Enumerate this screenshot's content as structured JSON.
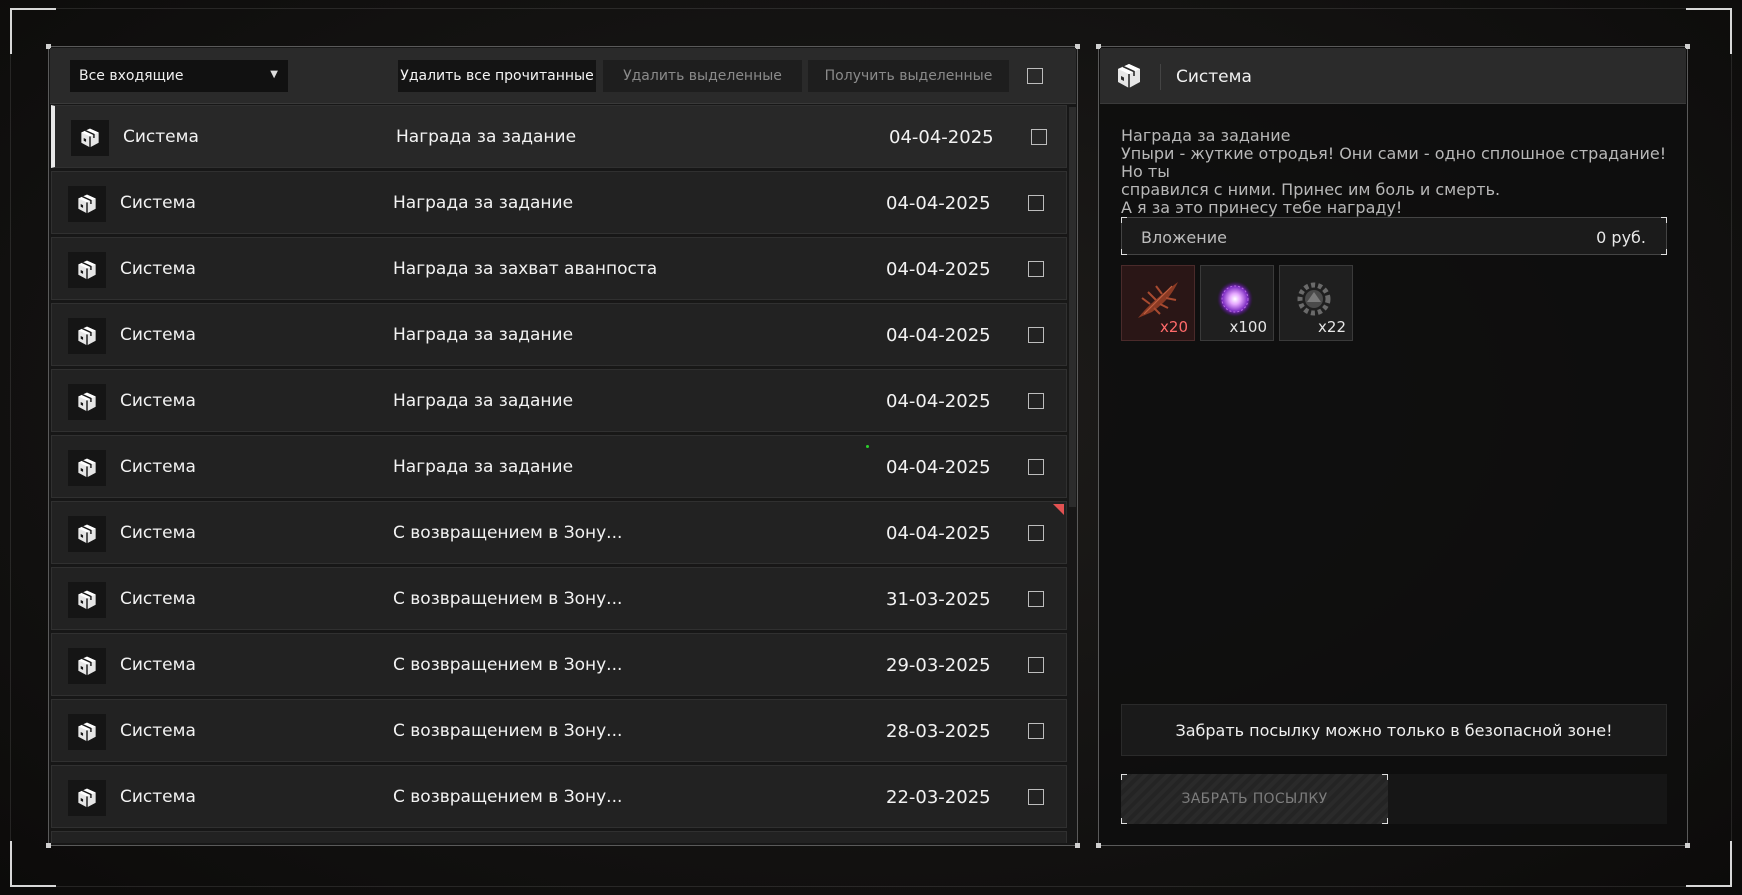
{
  "toolbar": {
    "filter_value": "Все входящие",
    "delete_read_label": "Удалить все прочитанные",
    "delete_selected_label": "Удалить выделенные",
    "receive_selected_label": "Получить выделенные"
  },
  "messages": [
    {
      "sender": "Система",
      "subject": "Награда за задание",
      "date": "04-04-2025",
      "selected": true
    },
    {
      "sender": "Система",
      "subject": "Награда за задание",
      "date": "04-04-2025"
    },
    {
      "sender": "Система",
      "subject": "Награда за захват аванпоста",
      "date": "04-04-2025"
    },
    {
      "sender": "Система",
      "subject": "Награда за задание",
      "date": "04-04-2025"
    },
    {
      "sender": "Система",
      "subject": "Награда за задание",
      "date": "04-04-2025"
    },
    {
      "sender": "Система",
      "subject": "Награда за задание",
      "date": "04-04-2025"
    },
    {
      "sender": "Система",
      "subject": "С возвращением в Зону...",
      "date": "04-04-2025",
      "flag": true
    },
    {
      "sender": "Система",
      "subject": "С возвращением в Зону...",
      "date": "31-03-2025"
    },
    {
      "sender": "Система",
      "subject": "С возвращением в Зону...",
      "date": "29-03-2025"
    },
    {
      "sender": "Система",
      "subject": "С возвращением в Зону...",
      "date": "28-03-2025"
    },
    {
      "sender": "Система",
      "subject": "С возвращением в Зону...",
      "date": "22-03-2025"
    }
  ],
  "detail": {
    "sender": "Система",
    "subject": "Награда за задание",
    "body_lines": [
      "Упыри - жуткие отродья! Они сами - одно сплошное страдание! Но ты",
      "справился с ними. Принес им боль и смерть.",
      "А я за это принесу тебе награду!"
    ],
    "attachment_label": "Вложение",
    "attachment_value": "0  руб.",
    "items": [
      {
        "name": "red-feather-item",
        "qty": "x20"
      },
      {
        "name": "purple-orb-item",
        "qty": "x100"
      },
      {
        "name": "gear-emblem-item",
        "qty": "x22"
      }
    ],
    "notice": "Забрать посылку можно только в безопасной зоне!",
    "take_button_label": "ЗАБРАТЬ ПОСЫЛКУ"
  },
  "colors": {
    "flag": "#e25252",
    "item_qty_highlight": "#ff6a6a",
    "status_dot": "#2bd12b"
  }
}
